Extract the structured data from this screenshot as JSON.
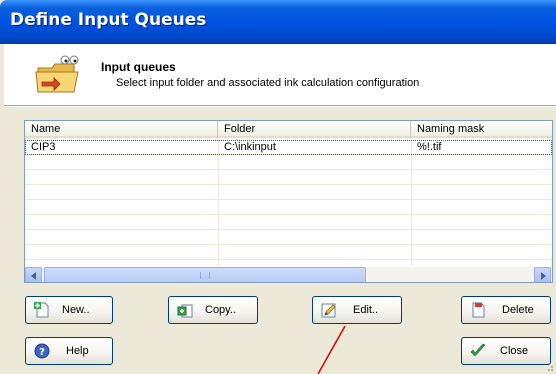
{
  "window": {
    "title": "Define Input Queues"
  },
  "header": {
    "title": "Input queues",
    "subtitle": "Select input folder and associated ink calculation configuration"
  },
  "list": {
    "columns": [
      "Name",
      "Folder",
      "Naming mask"
    ],
    "rows": [
      {
        "name": "CIP3",
        "folder": "C:\\inkinput",
        "mask": "%!.tif"
      }
    ]
  },
  "buttons": {
    "new": "New..",
    "copy": "Copy..",
    "edit": "Edit..",
    "delete": "Delete",
    "help": "Help",
    "close": "Close"
  },
  "colors": {
    "title_bar": "#0054e3",
    "annotation_line": "#e00000"
  }
}
